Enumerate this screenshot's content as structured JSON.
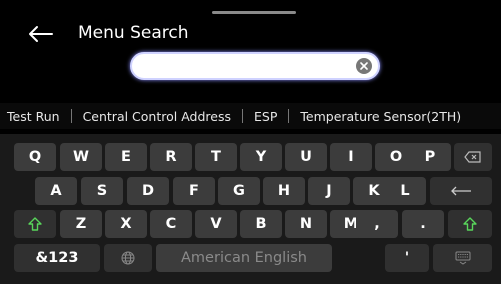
{
  "header": {
    "title": "Menu Search"
  },
  "search": {
    "value": "",
    "placeholder": ""
  },
  "suggestions": [
    "Test Run",
    "Central Control Address",
    "ESP",
    "Temperature Sensor(2TH)"
  ],
  "keyboard": {
    "row1": [
      "Q",
      "W",
      "E",
      "R",
      "T",
      "Y",
      "U",
      "I",
      "O",
      "P"
    ],
    "row2": [
      "A",
      "S",
      "D",
      "F",
      "G",
      "H",
      "J",
      "K",
      "L"
    ],
    "row3": [
      "Z",
      "X",
      "C",
      "V",
      "B",
      "N",
      "M",
      ",",
      "."
    ],
    "numbers_label": "&123",
    "space_label": "American English",
    "apostrophe": "'"
  },
  "colors": {
    "shift_arrow": "#59d65b",
    "accent_glow": "#8c90ff"
  },
  "icons": [
    "back-arrow-icon",
    "clear-icon",
    "backspace-icon",
    "enter-icon",
    "shift-icon",
    "globe-icon",
    "keyboard-hide-icon"
  ]
}
